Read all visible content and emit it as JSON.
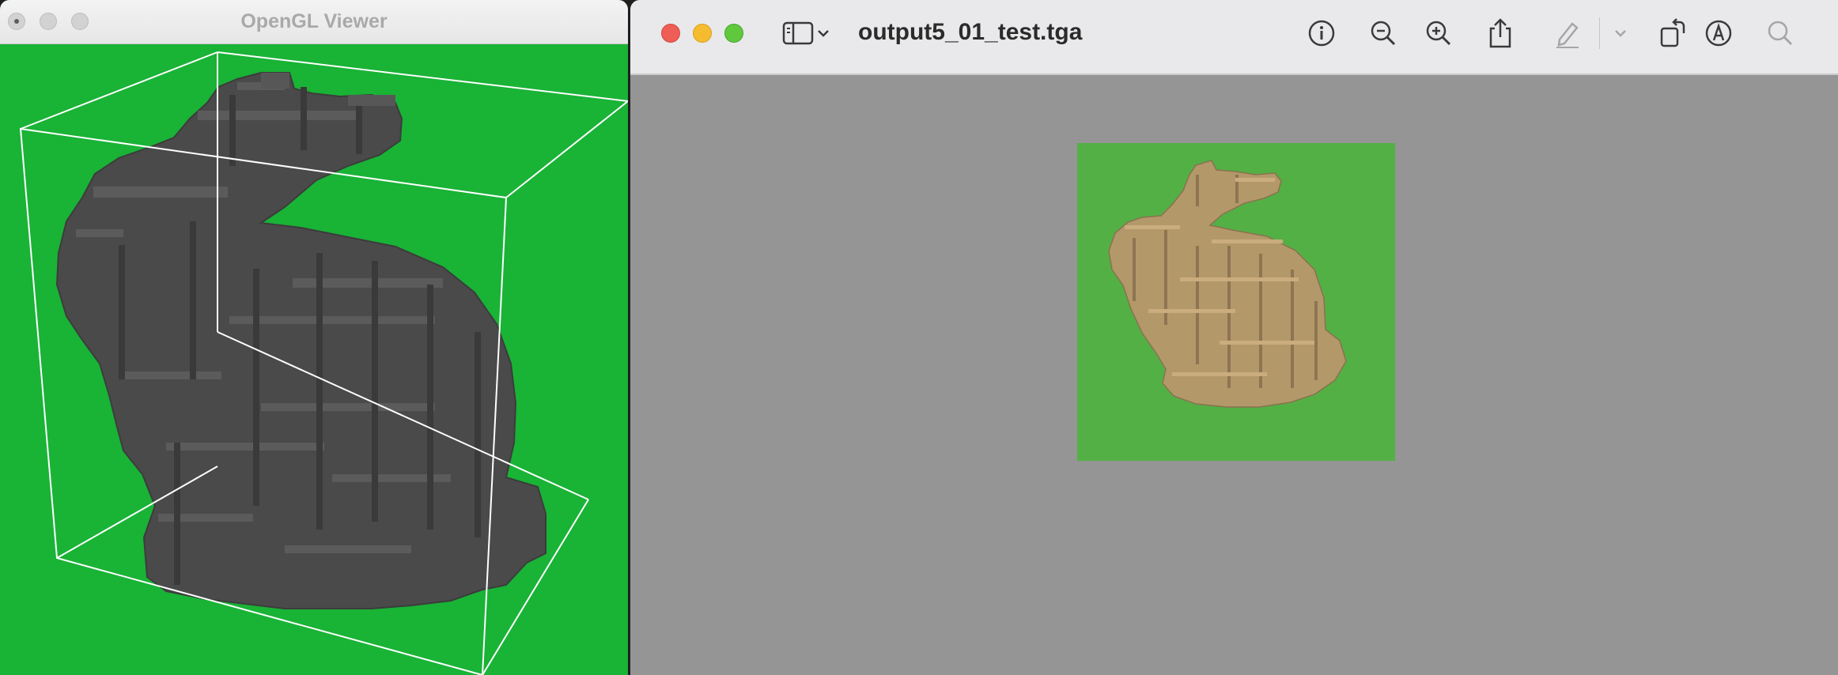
{
  "gl_window": {
    "title": "OpenGL Viewer",
    "background_color": "#19b336",
    "model_color": "#4a4a4a",
    "bounding_box_color": "#ffffff"
  },
  "preview_window": {
    "title": "output5_01_test.tga",
    "canvas_color": "#959595",
    "image_background_color": "#53b045",
    "model_color": "#b79b6f",
    "toolbar": {
      "icons": [
        "sidebar-icon",
        "chevron-down-icon",
        "info-icon",
        "zoom-out-icon",
        "zoom-in-icon",
        "share-icon",
        "markup-pen-icon",
        "chevron-down-icon",
        "rotate-icon",
        "annotate-icon",
        "search-icon"
      ]
    }
  }
}
